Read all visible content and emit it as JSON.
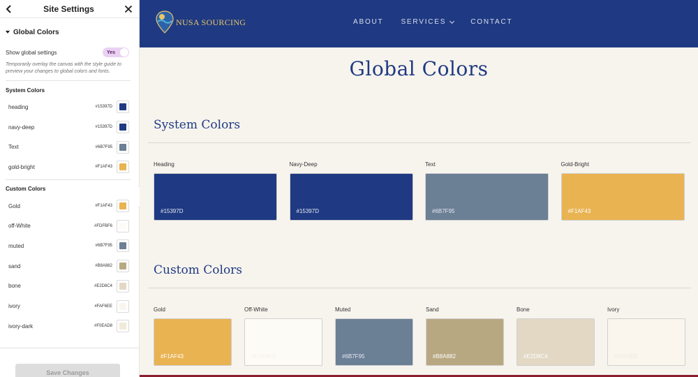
{
  "panel": {
    "title": "Site Settings",
    "section_title": "Global Colors",
    "show_global_label": "Show global settings",
    "toggle_label": "Yes",
    "hint": "Temporarily overlay the canvas with the style guide to preview your changes to global colors and fonts.",
    "system_title": "System Colors",
    "system_colors": [
      {
        "name": "heading",
        "hex": "#15397D",
        "color": "#1F3A82"
      },
      {
        "name": "navy-deep",
        "hex": "#15397D",
        "color": "#1F3A82"
      },
      {
        "name": "Text",
        "hex": "#6B7F95",
        "color": "#6B7F95"
      },
      {
        "name": "gold-bright",
        "hex": "#F1AF43",
        "color": "#E9B352"
      }
    ],
    "custom_title": "Custom Colors",
    "custom_colors": [
      {
        "name": "Gold",
        "hex": "#F1AF43",
        "color": "#E9B352"
      },
      {
        "name": "off-White",
        "hex": "#FDFBF6",
        "color": "#FDFBF6"
      },
      {
        "name": "muted",
        "hex": "#6B7F95",
        "color": "#6B7F95"
      },
      {
        "name": "sand",
        "hex": "#B8A882",
        "color": "#B8A882"
      },
      {
        "name": "bone",
        "hex": "#E2D8C4",
        "color": "#E2D8C4"
      },
      {
        "name": "ivory",
        "hex": "#FAF6EE",
        "color": "#FAF6EE"
      },
      {
        "name": "ivory-dark",
        "hex": "#F0EAD8",
        "color": "#F0EAD8"
      }
    ],
    "save_label": "Save Changes"
  },
  "site": {
    "logo_text": "NUSA SOURCING",
    "nav": {
      "about": "ABOUT",
      "services": "SERVICES",
      "contact": "CONTACT"
    },
    "page_title": "Global Colors",
    "system_section_title": "System Colors",
    "system_cards": [
      {
        "label": "Heading",
        "hex": "#15397D",
        "color": "#1F3A82",
        "text_color": "#E6E9F3"
      },
      {
        "label": "Navy-Deep",
        "hex": "#15397D",
        "color": "#1F3A82",
        "text_color": "#E6E9F3"
      },
      {
        "label": "Text",
        "hex": "#6B7F95",
        "color": "#6B7F95",
        "text_color": "#E6E9F3"
      },
      {
        "label": "Gold-Bright",
        "hex": "#F1AF43",
        "color": "#E9B352",
        "text_color": "#FFFFFF"
      }
    ],
    "custom_section_title": "Custom Colors",
    "custom_cards": [
      {
        "label": "Gold",
        "hex": "#F1AF43",
        "color": "#E9B352",
        "text_color": "#FFFFFF"
      },
      {
        "label": "Off-White",
        "hex": "#FDFBF6",
        "color": "#FDFBF6",
        "text_color": "#F3F0EA"
      },
      {
        "label": "Muted",
        "hex": "#6B7F95",
        "color": "#6B7F95",
        "text_color": "#E6E9F3"
      },
      {
        "label": "Sand",
        "hex": "#B8A882",
        "color": "#B8A882",
        "text_color": "#FFFFFF"
      },
      {
        "label": "Bone",
        "hex": "#E2D8C4",
        "color": "#E2D8C4",
        "text_color": "#FFFFFF"
      },
      {
        "label": "Ivory",
        "hex": "#FAF6EE",
        "color": "#FAF6EE",
        "text_color": "#EFEAE0"
      }
    ]
  }
}
